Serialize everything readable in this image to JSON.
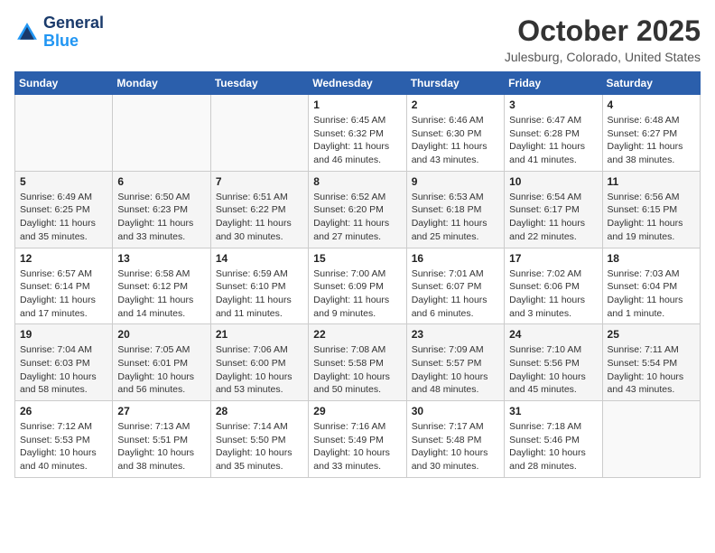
{
  "header": {
    "logo_line1": "General",
    "logo_line2": "Blue",
    "month_title": "October 2025",
    "location": "Julesburg, Colorado, United States"
  },
  "days_of_week": [
    "Sunday",
    "Monday",
    "Tuesday",
    "Wednesday",
    "Thursday",
    "Friday",
    "Saturday"
  ],
  "weeks": [
    [
      {
        "day": "",
        "info": ""
      },
      {
        "day": "",
        "info": ""
      },
      {
        "day": "",
        "info": ""
      },
      {
        "day": "1",
        "info": "Sunrise: 6:45 AM\nSunset: 6:32 PM\nDaylight: 11 hours\nand 46 minutes."
      },
      {
        "day": "2",
        "info": "Sunrise: 6:46 AM\nSunset: 6:30 PM\nDaylight: 11 hours\nand 43 minutes."
      },
      {
        "day": "3",
        "info": "Sunrise: 6:47 AM\nSunset: 6:28 PM\nDaylight: 11 hours\nand 41 minutes."
      },
      {
        "day": "4",
        "info": "Sunrise: 6:48 AM\nSunset: 6:27 PM\nDaylight: 11 hours\nand 38 minutes."
      }
    ],
    [
      {
        "day": "5",
        "info": "Sunrise: 6:49 AM\nSunset: 6:25 PM\nDaylight: 11 hours\nand 35 minutes."
      },
      {
        "day": "6",
        "info": "Sunrise: 6:50 AM\nSunset: 6:23 PM\nDaylight: 11 hours\nand 33 minutes."
      },
      {
        "day": "7",
        "info": "Sunrise: 6:51 AM\nSunset: 6:22 PM\nDaylight: 11 hours\nand 30 minutes."
      },
      {
        "day": "8",
        "info": "Sunrise: 6:52 AM\nSunset: 6:20 PM\nDaylight: 11 hours\nand 27 minutes."
      },
      {
        "day": "9",
        "info": "Sunrise: 6:53 AM\nSunset: 6:18 PM\nDaylight: 11 hours\nand 25 minutes."
      },
      {
        "day": "10",
        "info": "Sunrise: 6:54 AM\nSunset: 6:17 PM\nDaylight: 11 hours\nand 22 minutes."
      },
      {
        "day": "11",
        "info": "Sunrise: 6:56 AM\nSunset: 6:15 PM\nDaylight: 11 hours\nand 19 minutes."
      }
    ],
    [
      {
        "day": "12",
        "info": "Sunrise: 6:57 AM\nSunset: 6:14 PM\nDaylight: 11 hours\nand 17 minutes."
      },
      {
        "day": "13",
        "info": "Sunrise: 6:58 AM\nSunset: 6:12 PM\nDaylight: 11 hours\nand 14 minutes."
      },
      {
        "day": "14",
        "info": "Sunrise: 6:59 AM\nSunset: 6:10 PM\nDaylight: 11 hours\nand 11 minutes."
      },
      {
        "day": "15",
        "info": "Sunrise: 7:00 AM\nSunset: 6:09 PM\nDaylight: 11 hours\nand 9 minutes."
      },
      {
        "day": "16",
        "info": "Sunrise: 7:01 AM\nSunset: 6:07 PM\nDaylight: 11 hours\nand 6 minutes."
      },
      {
        "day": "17",
        "info": "Sunrise: 7:02 AM\nSunset: 6:06 PM\nDaylight: 11 hours\nand 3 minutes."
      },
      {
        "day": "18",
        "info": "Sunrise: 7:03 AM\nSunset: 6:04 PM\nDaylight: 11 hours\nand 1 minute."
      }
    ],
    [
      {
        "day": "19",
        "info": "Sunrise: 7:04 AM\nSunset: 6:03 PM\nDaylight: 10 hours\nand 58 minutes."
      },
      {
        "day": "20",
        "info": "Sunrise: 7:05 AM\nSunset: 6:01 PM\nDaylight: 10 hours\nand 56 minutes."
      },
      {
        "day": "21",
        "info": "Sunrise: 7:06 AM\nSunset: 6:00 PM\nDaylight: 10 hours\nand 53 minutes."
      },
      {
        "day": "22",
        "info": "Sunrise: 7:08 AM\nSunset: 5:58 PM\nDaylight: 10 hours\nand 50 minutes."
      },
      {
        "day": "23",
        "info": "Sunrise: 7:09 AM\nSunset: 5:57 PM\nDaylight: 10 hours\nand 48 minutes."
      },
      {
        "day": "24",
        "info": "Sunrise: 7:10 AM\nSunset: 5:56 PM\nDaylight: 10 hours\nand 45 minutes."
      },
      {
        "day": "25",
        "info": "Sunrise: 7:11 AM\nSunset: 5:54 PM\nDaylight: 10 hours\nand 43 minutes."
      }
    ],
    [
      {
        "day": "26",
        "info": "Sunrise: 7:12 AM\nSunset: 5:53 PM\nDaylight: 10 hours\nand 40 minutes."
      },
      {
        "day": "27",
        "info": "Sunrise: 7:13 AM\nSunset: 5:51 PM\nDaylight: 10 hours\nand 38 minutes."
      },
      {
        "day": "28",
        "info": "Sunrise: 7:14 AM\nSunset: 5:50 PM\nDaylight: 10 hours\nand 35 minutes."
      },
      {
        "day": "29",
        "info": "Sunrise: 7:16 AM\nSunset: 5:49 PM\nDaylight: 10 hours\nand 33 minutes."
      },
      {
        "day": "30",
        "info": "Sunrise: 7:17 AM\nSunset: 5:48 PM\nDaylight: 10 hours\nand 30 minutes."
      },
      {
        "day": "31",
        "info": "Sunrise: 7:18 AM\nSunset: 5:46 PM\nDaylight: 10 hours\nand 28 minutes."
      },
      {
        "day": "",
        "info": ""
      }
    ]
  ]
}
